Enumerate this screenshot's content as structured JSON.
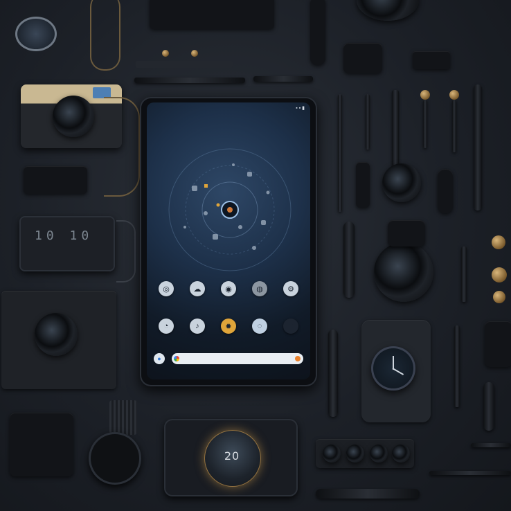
{
  "scene": {
    "description_colors": {
      "background": "#1c2027",
      "screen_accent": "#2e4766",
      "search_bar": "#e9eef3"
    }
  },
  "phone": {
    "status_time": "",
    "app_rows": [
      [
        {
          "icon": "compass-icon",
          "label": "",
          "color": "#c9d3dd"
        },
        {
          "icon": "cloud-icon",
          "label": "",
          "color": "#c9d3dd"
        },
        {
          "icon": "camera-icon",
          "label": "",
          "color": "#c9d3dd"
        },
        {
          "icon": "globe-icon",
          "label": "",
          "color": "#8c96a1"
        },
        {
          "icon": "settings-icon",
          "label": "",
          "color": "#c9d3dd"
        }
      ],
      [
        {
          "icon": "clock-icon",
          "label": "",
          "color": "#c9d3dd"
        },
        {
          "icon": "music-icon",
          "label": "",
          "color": "#c9d3dd"
        },
        {
          "icon": "sun-icon",
          "label": "",
          "color": "#e0a53a"
        },
        {
          "icon": "chat-icon",
          "label": "",
          "color": "#bfd0e2"
        },
        {
          "icon": "grid-icon",
          "label": "",
          "color": "#1c2430"
        }
      ]
    ],
    "search": {
      "placeholder": ""
    }
  },
  "smart_display": {
    "text": "20"
  },
  "label_plate": {
    "text": "10 10"
  }
}
